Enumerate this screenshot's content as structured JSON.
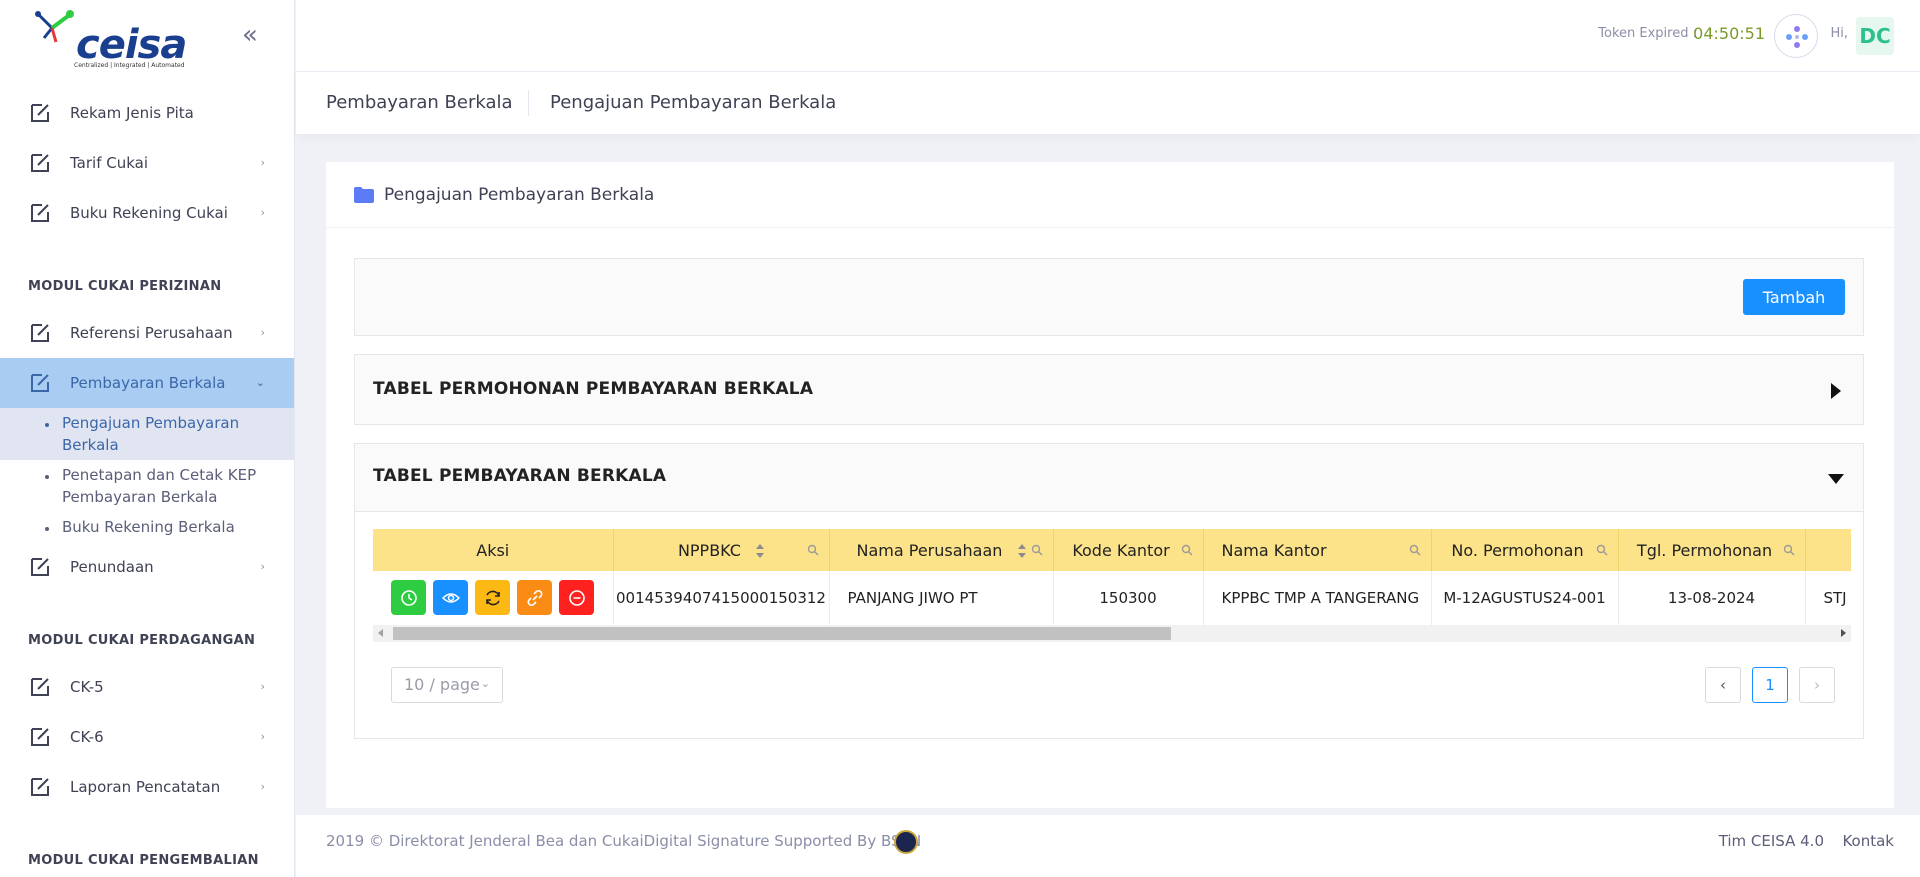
{
  "brand": {
    "logo_text": "ceisa",
    "logo_tagline": "Centralized | Integrated | Automated"
  },
  "header": {
    "token_label": "Token Expired :",
    "token_value": "04:50:51",
    "greeting": "Hi,",
    "avatar_initials": "DC"
  },
  "sidebar": {
    "items_top": [
      {
        "label": "Rekam Jenis Pita",
        "has_children": false
      },
      {
        "label": "Tarif Cukai",
        "has_children": true
      },
      {
        "label": "Buku Rekening Cukai",
        "has_children": true
      }
    ],
    "section1": "MODUL CUKAI PERIZINAN",
    "item_referensi": "Referensi Perusahaan",
    "item_pembayaran": "Pembayaran Berkala",
    "sub_items": [
      "Pengajuan Pembayaran Berkala",
      "Penetapan dan Cetak KEP Pembayaran Berkala",
      "Buku Rekening Berkala"
    ],
    "item_penundaan": "Penundaan",
    "section2": "MODUL CUKAI PERDAGANGAN",
    "items_perdagangan": [
      "CK-5",
      "CK-6",
      "Laporan Pencatatan"
    ],
    "section3": "MODUL CUKAI PENGEMBALIAN"
  },
  "breadcrumb": {
    "parent": "Pembayaran Berkala",
    "current": "Pengajuan Pembayaran Berkala"
  },
  "card": {
    "title": "Pengajuan Pembayaran Berkala",
    "add_button": "Tambah",
    "panel_permohonan_title": "TABEL PERMOHONAN PEMBAYARAN BERKALA",
    "panel_pembayaran_title": "TABEL PEMBAYARAN BERKALA"
  },
  "table": {
    "columns": [
      "Aksi",
      "NPPBKC",
      "Nama Perusahaan",
      "Kode Kantor",
      "Nama Kantor",
      "No. Permohonan",
      "Tgl. Permohonan",
      ""
    ],
    "rows": [
      {
        "nppbkc": "0014539407415000150312",
        "nama_perusahaan": "PANJANG JIWO PT",
        "kode_kantor": "150300",
        "nama_kantor": "KPPBC TMP A TANGERANG",
        "no_permohonan": "M-12AGUSTUS24-001",
        "tgl_permohonan": "13-08-2024",
        "extra": "STJ"
      }
    ],
    "action_colors": {
      "history": "#2ecc40",
      "view": "#1890ff",
      "refresh": "#fdb913",
      "link": "#fa8c16",
      "remove": "#ff2020"
    }
  },
  "pagination": {
    "page_size": "10 / page",
    "current_page": "1"
  },
  "footer": {
    "copyright": "2019 © Direktorat Jenderal Bea dan CukaiDigital Signature Supported By BSSN",
    "link_team": "Tim CEISA 4.0",
    "link_contact": "Kontak"
  },
  "colors": {
    "accent": "#1890ff",
    "active_nav": "#a9cdf2",
    "table_header": "#fce38a"
  }
}
